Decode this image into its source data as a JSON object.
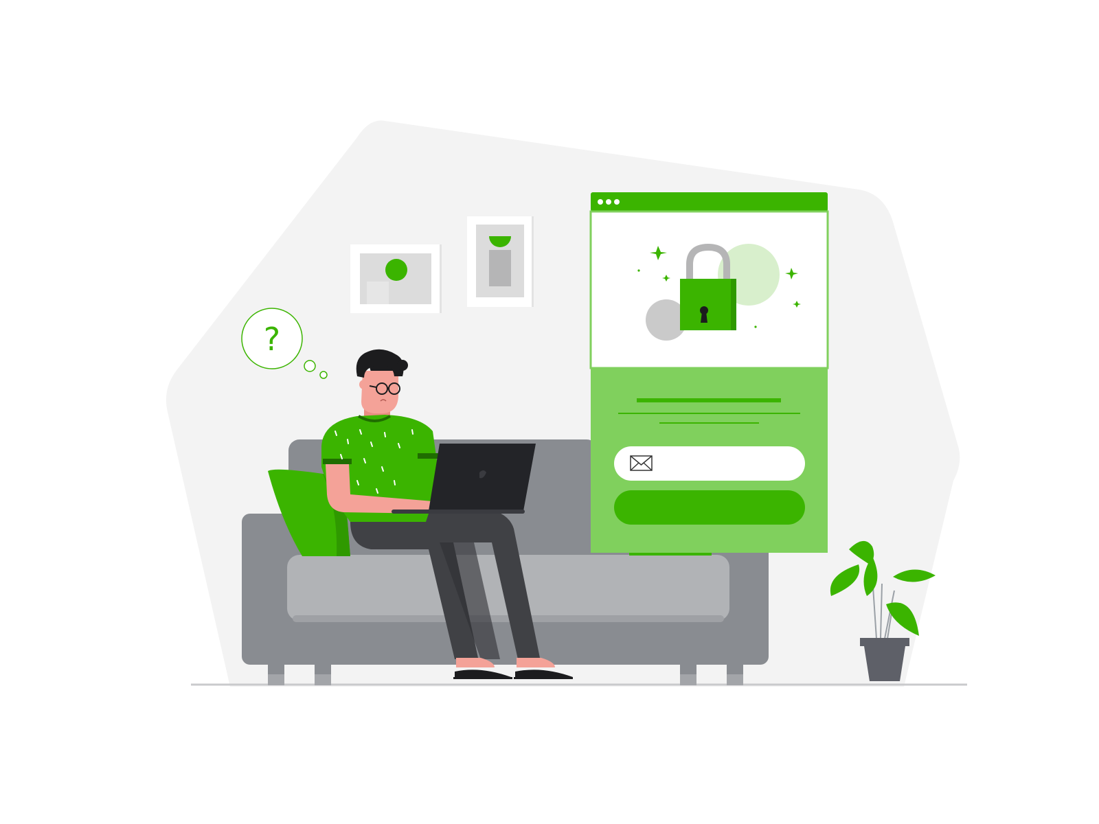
{
  "scene": {
    "thought_bubble": {
      "symbol": "?"
    },
    "login_window": {
      "titlebar_dots": 3,
      "email_field": {
        "value": "",
        "icon": "envelope-icon"
      },
      "submit_button": {
        "label": ""
      },
      "hero_icon": "padlock-icon"
    }
  },
  "colors": {
    "accent": "#3bb400",
    "accent_light": "#80d05d",
    "accent_pale": "#d8efcc",
    "backdrop": "#f3f3f3",
    "sofa": "#898c91",
    "sofa_cushion": "#b1b3b6",
    "laptop": "#232428",
    "pants": "#404145",
    "skin": "#f4a298",
    "hair": "#1c1c1e",
    "pot": "#5e6068"
  }
}
